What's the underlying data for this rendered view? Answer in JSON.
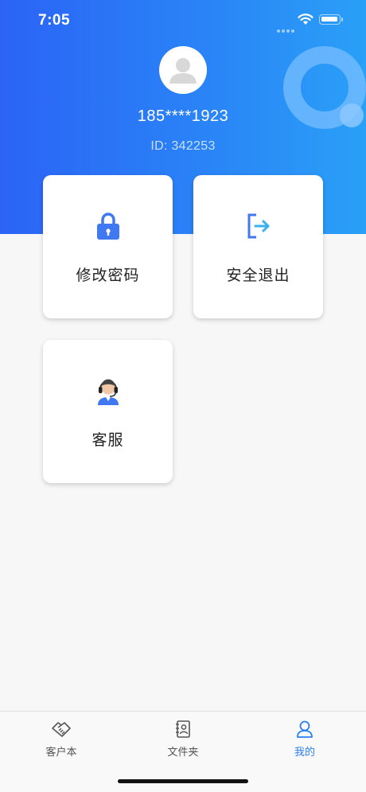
{
  "status_bar": {
    "time": "7:05",
    "icons": [
      "cellular-signal-icon",
      "wifi-icon",
      "battery-icon"
    ]
  },
  "profile": {
    "phone": "185****1923",
    "user_id": "ID: 342253",
    "avatar_icon": "default-avatar-icon"
  },
  "actions": [
    {
      "label": "修改密码",
      "icon": "lock-icon"
    },
    {
      "label": "安全退出",
      "icon": "logout-icon"
    },
    {
      "label": "客服",
      "icon": "customer-service-icon"
    }
  ],
  "tabbar": {
    "tabs": [
      {
        "label": "客户本",
        "icon": "handshake-icon",
        "active": false
      },
      {
        "label": "文件夹",
        "icon": "contact-book-icon",
        "active": false
      },
      {
        "label": "我的",
        "icon": "user-icon",
        "active": true
      }
    ]
  },
  "colors": {
    "header_gradient_start": "#2b63f6",
    "header_gradient_end": "#2aa0f7",
    "accent": "#2a7ff2",
    "background": "#f7f7f7"
  }
}
